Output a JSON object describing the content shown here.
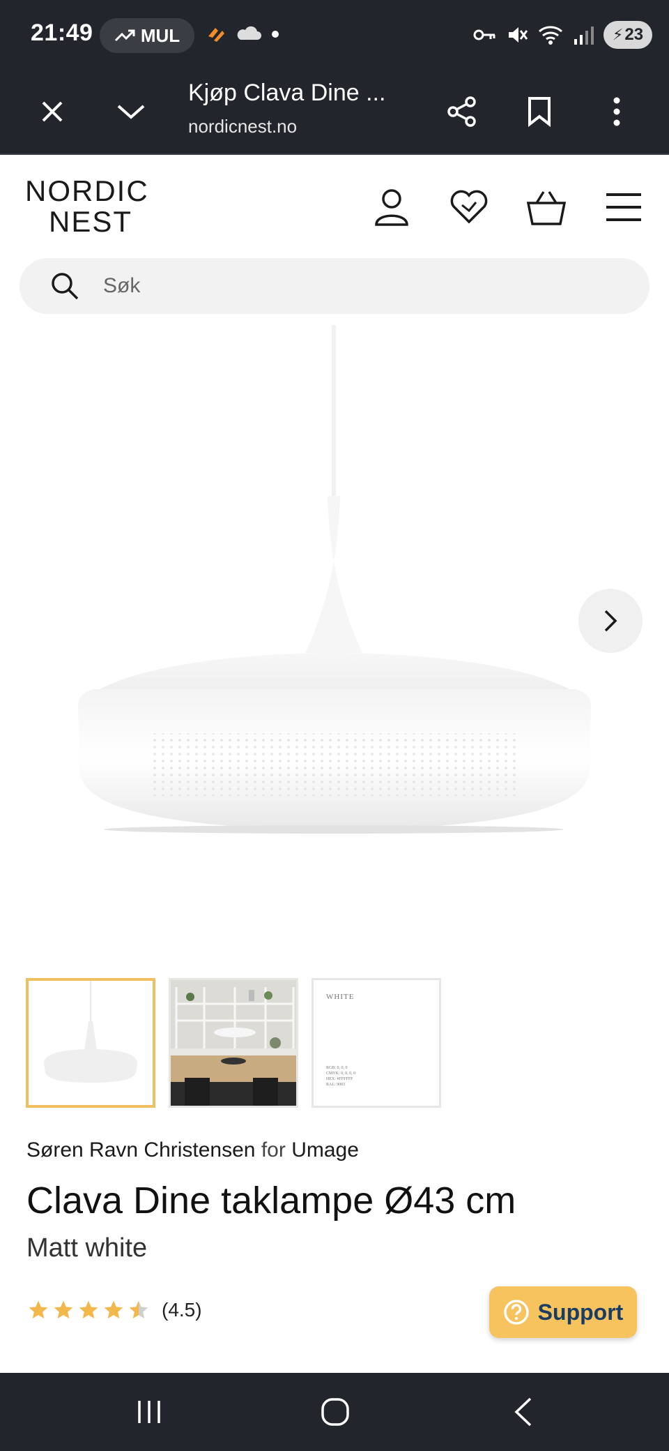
{
  "status_bar": {
    "time": "21:49",
    "pill_label": "MUL",
    "battery": "23",
    "icons": [
      "trend-up-icon",
      "fire-icon",
      "cloud-icon",
      "dot-icon",
      "key-icon",
      "mute-icon",
      "wifi-icon",
      "signal-icon",
      "battery-icon"
    ]
  },
  "browser": {
    "title": "Kjøp Clava Dine ...",
    "url": "nordicnest.no"
  },
  "site": {
    "logo_line1": "NORDIC",
    "logo_line2": "NEST",
    "search_placeholder": "Søk"
  },
  "thumbnails": {
    "third_label": "WHITE",
    "third_codes": [
      "RGB: 0, 0, 0",
      "CMYK: 0, 0, 0, 0",
      "HEX: #FFFFFF",
      "RAL: 9003"
    ]
  },
  "product": {
    "designer": "Søren Ravn Christensen",
    "for_text": "for",
    "brand": "Umage",
    "title": "Clava Dine taklampe Ø43 cm",
    "variant": "Matt white",
    "rating_value": 4.5,
    "rating_text": "(4.5)"
  },
  "support": {
    "label": "Support"
  },
  "colors": {
    "chrome_dark": "#22252b",
    "accent_yellow": "#f6c35e",
    "star": "#f2b84b",
    "thumb_active_border": "#f0c060"
  }
}
